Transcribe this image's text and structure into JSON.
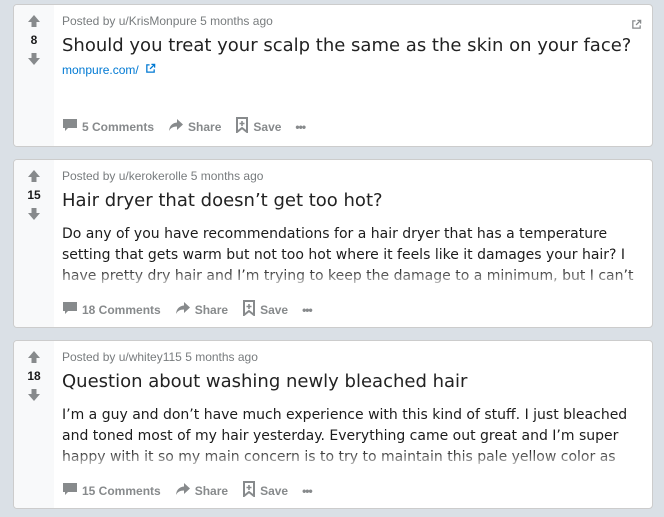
{
  "posts": [
    {
      "score": "8",
      "meta": "Posted by u/KrisMonpure 5 months ago",
      "title": "Should you treat your scalp the same as the skin on your face?",
      "link": "monpure.com/",
      "text": "",
      "comments": "5 Comments",
      "share": "Share",
      "save": "Save",
      "more": "•••"
    },
    {
      "score": "15",
      "meta": "Posted by u/kerokerolle 5 months ago",
      "title": "Hair dryer that doesn’t get too hot?",
      "link": "",
      "text": "Do any of you have recommendations for a hair dryer that has a temperature setting that gets warm but not too hot where it feels like it damages your hair? I have pretty dry hair and I’m trying to keep the damage to a minimum, but I can’t always wait around for",
      "comments": "18 Comments",
      "share": "Share",
      "save": "Save",
      "more": "•••"
    },
    {
      "score": "18",
      "meta": "Posted by u/whitey115 5 months ago",
      "title": "Question about washing newly bleached hair",
      "link": "",
      "text": "I’m a guy and don’t have much experience with this kind of stuff. I just bleached and toned most of my hair yesterday. Everything came out great and I’m super happy with it so my main concern is to try to maintain this pale yellow color as much as possible.",
      "comments": "15 Comments",
      "share": "Share",
      "save": "Save",
      "more": "•••"
    }
  ],
  "icons": {
    "upvote": "arrow-up-icon",
    "downvote": "arrow-down-icon",
    "comment": "comment-icon",
    "share": "share-icon",
    "save": "bookmark-icon",
    "external": "external-link-icon"
  },
  "colors": {
    "link": "#0079d3",
    "muted": "#878a8c",
    "background": "#dae0e6"
  }
}
